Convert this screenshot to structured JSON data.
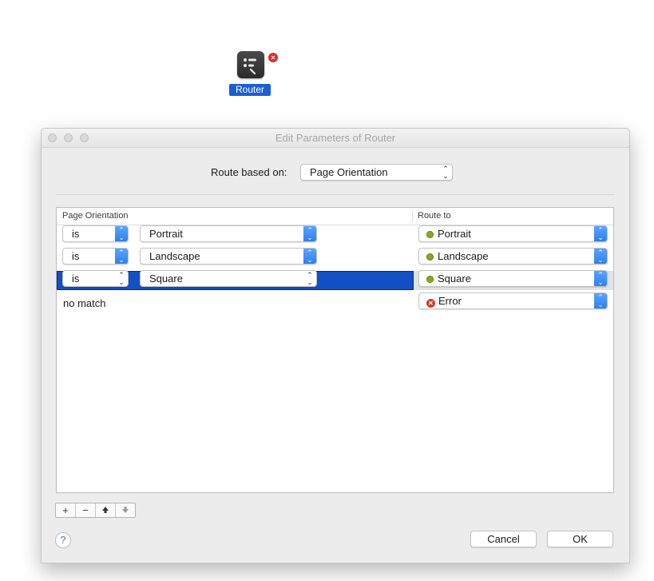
{
  "node": {
    "label": "Router",
    "error_glyph": "×"
  },
  "dialog": {
    "title": "Edit Parameters of Router",
    "route_label": "Route based on:",
    "route_value": "Page Orientation",
    "table": {
      "col_condition": "Page Orientation",
      "col_route": "Route to",
      "rows": [
        {
          "op": "is",
          "value": "Portrait",
          "route": "Portrait",
          "route_status": "ok"
        },
        {
          "op": "is",
          "value": "Landscape",
          "route": "Landscape",
          "route_status": "ok"
        },
        {
          "op": "is",
          "value": "Square",
          "route": "Square",
          "route_status": "ok",
          "selected": true
        }
      ],
      "nomatch_label": "no match",
      "nomatch_route": "Error",
      "nomatch_status": "error"
    },
    "row_buttons": {
      "add": "+",
      "remove": "−",
      "up": "🡅",
      "down": "🡇"
    },
    "help": "?",
    "cancel": "Cancel",
    "ok": "OK"
  },
  "colors": {
    "accent": "#1350c5",
    "ok_dot": "#8aa624",
    "error": "#d33a2c"
  }
}
